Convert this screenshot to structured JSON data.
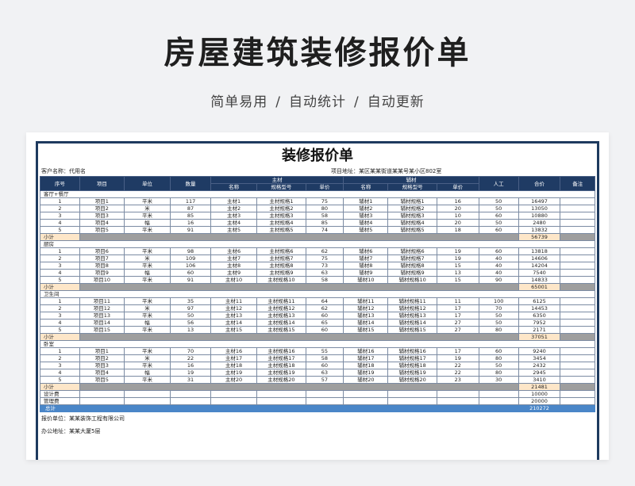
{
  "header": {
    "title": "房屋建筑装修报价单",
    "subtitle_parts": [
      "简单易用",
      "自动统计",
      "自动更新"
    ],
    "separator": "/"
  },
  "sheet": {
    "title": "装修报价单",
    "client_label": "客户名称：代用名",
    "address_label": "项目地址：某区某某街道某某号某小区802室",
    "columns": {
      "no": "序号",
      "item": "项目",
      "unit": "单位",
      "qty": "数量",
      "main_group": "主材",
      "aux_group": "辅材",
      "name": "名称",
      "spec": "规格型号",
      "price": "单价",
      "labor": "人工",
      "total": "合价",
      "note": "备注"
    },
    "sections": [
      {
        "name": "客厅+餐厅",
        "rows": [
          [
            "1",
            "项目1",
            "平米",
            "117",
            "主材1",
            "主材规格1",
            "75",
            "辅材1",
            "辅材规格1",
            "16",
            "50",
            "16497",
            ""
          ],
          [
            "2",
            "项目2",
            "米",
            "87",
            "主材2",
            "主材规格2",
            "80",
            "辅材2",
            "辅材规格2",
            "20",
            "50",
            "13050",
            ""
          ],
          [
            "3",
            "项目3",
            "平米",
            "85",
            "主材3",
            "主材规格3",
            "58",
            "辅材3",
            "辅材规格3",
            "10",
            "60",
            "10880",
            ""
          ],
          [
            "4",
            "项目4",
            "幅",
            "16",
            "主材4",
            "主材规格4",
            "85",
            "辅材4",
            "辅材规格4",
            "20",
            "50",
            "2480",
            ""
          ],
          [
            "5",
            "项目5",
            "平米",
            "91",
            "主材5",
            "主材规格5",
            "74",
            "辅材5",
            "辅材规格5",
            "18",
            "60",
            "13832",
            ""
          ]
        ],
        "subtotal_label": "小计",
        "subtotal": "56739"
      },
      {
        "name": "厨房",
        "rows": [
          [
            "1",
            "项目6",
            "平米",
            "98",
            "主材6",
            "主材规格6",
            "62",
            "辅材6",
            "辅材规格6",
            "19",
            "60",
            "13818",
            ""
          ],
          [
            "2",
            "项目7",
            "米",
            "109",
            "主材7",
            "主材规格7",
            "75",
            "辅材7",
            "辅材规格7",
            "19",
            "40",
            "14606",
            ""
          ],
          [
            "3",
            "项目8",
            "平米",
            "106",
            "主材8",
            "主材规格8",
            "73",
            "辅材8",
            "辅材规格8",
            "15",
            "40",
            "14204",
            ""
          ],
          [
            "4",
            "项目9",
            "幅",
            "60",
            "主材9",
            "主材规格9",
            "63",
            "辅材9",
            "辅材规格9",
            "13",
            "40",
            "7540",
            ""
          ],
          [
            "5",
            "项目10",
            "平米",
            "91",
            "主材10",
            "主材规格10",
            "58",
            "辅材10",
            "辅材规格10",
            "15",
            "90",
            "14833",
            ""
          ]
        ],
        "subtotal_label": "小计",
        "subtotal": "65001"
      },
      {
        "name": "卫生间",
        "rows": [
          [
            "1",
            "项目11",
            "平米",
            "35",
            "主材11",
            "主材规格11",
            "64",
            "辅材11",
            "辅材规格11",
            "11",
            "100",
            "6125",
            ""
          ],
          [
            "2",
            "项目12",
            "米",
            "97",
            "主材12",
            "主材规格12",
            "62",
            "辅材12",
            "辅材规格12",
            "17",
            "70",
            "14453",
            ""
          ],
          [
            "3",
            "项目13",
            "平米",
            "50",
            "主材13",
            "主材规格13",
            "60",
            "辅材13",
            "辅材规格13",
            "17",
            "50",
            "6350",
            ""
          ],
          [
            "4",
            "项目14",
            "幅",
            "56",
            "主材14",
            "主材规格14",
            "65",
            "辅材14",
            "辅材规格14",
            "27",
            "50",
            "7952",
            ""
          ],
          [
            "5",
            "项目15",
            "平米",
            "13",
            "主材15",
            "主材规格15",
            "60",
            "辅材15",
            "辅材规格15",
            "27",
            "80",
            "2171",
            ""
          ]
        ],
        "subtotal_label": "小计",
        "subtotal": "37051"
      },
      {
        "name": "卧室",
        "rows": [
          [
            "1",
            "项目1",
            "平米",
            "70",
            "主材16",
            "主材规格16",
            "55",
            "辅材16",
            "辅材规格16",
            "17",
            "60",
            "9240",
            ""
          ],
          [
            "2",
            "项目2",
            "米",
            "22",
            "主材17",
            "主材规格17",
            "58",
            "辅材17",
            "辅材规格17",
            "19",
            "80",
            "3454",
            ""
          ],
          [
            "3",
            "项目3",
            "平米",
            "16",
            "主材18",
            "主材规格18",
            "60",
            "辅材18",
            "辅材规格18",
            "22",
            "50",
            "2432",
            ""
          ],
          [
            "4",
            "项目4",
            "幅",
            "19",
            "主材19",
            "主材规格19",
            "63",
            "辅材19",
            "辅材规格19",
            "22",
            "80",
            "2945",
            ""
          ],
          [
            "5",
            "项目5",
            "平米",
            "31",
            "主材20",
            "主材规格20",
            "57",
            "辅材20",
            "辅材规格20",
            "23",
            "30",
            "3410",
            ""
          ]
        ],
        "subtotal_label": "小计",
        "subtotal": "21481"
      }
    ],
    "fees": [
      {
        "label": "设计费",
        "value": "10000"
      },
      {
        "label": "管理费",
        "value": "20000"
      }
    ],
    "grand_total": {
      "label": "总计",
      "value": "210272"
    },
    "quote_unit": "报价单位：某某装饰工程有限公司",
    "office_address": "办公地址：某某大厦5层"
  }
}
